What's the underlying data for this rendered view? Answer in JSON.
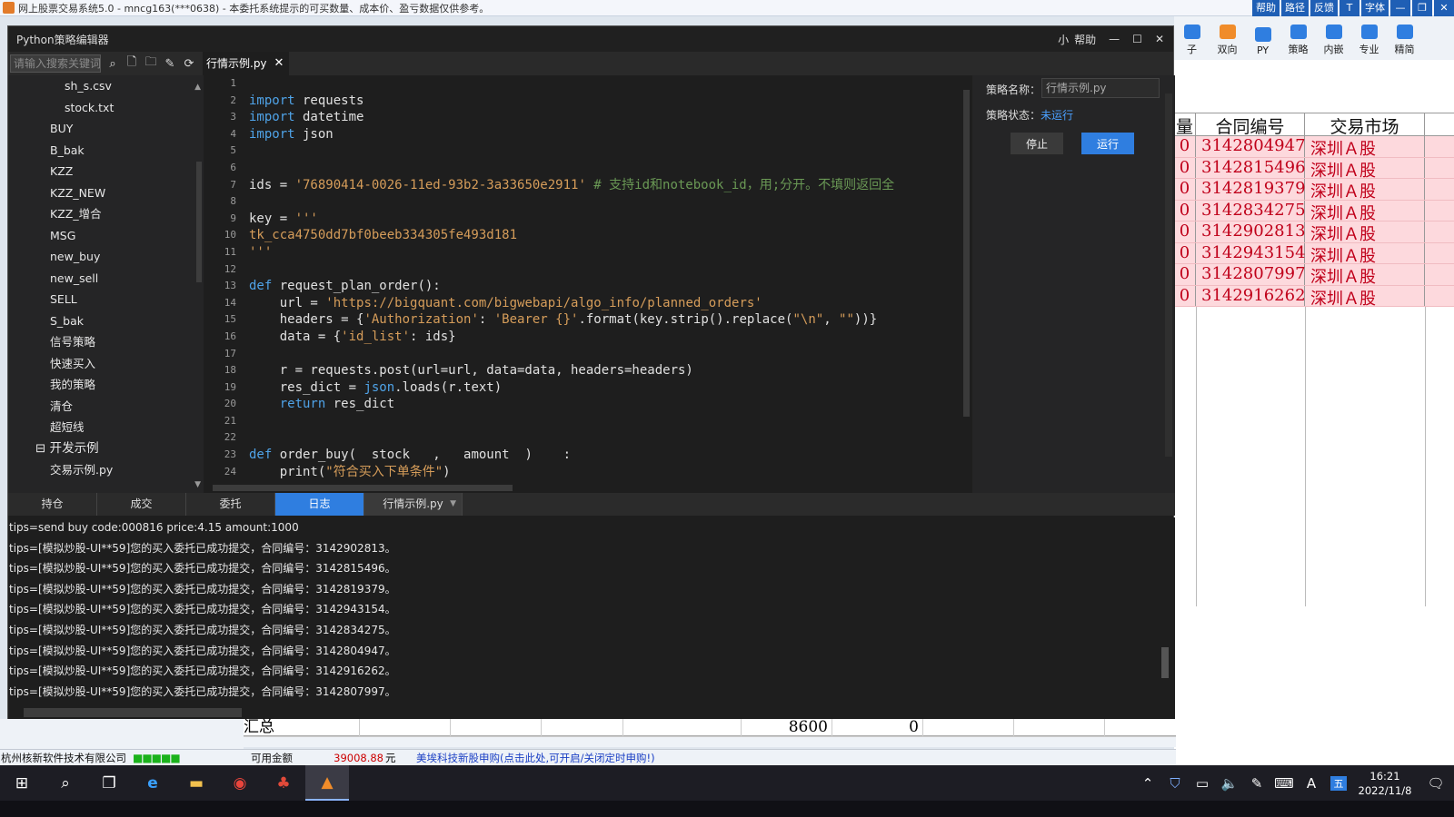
{
  "app": {
    "title": "网上股票交易系统5.0 - mncg163(***0638) - 本委托系统提示的可买数量、成本价、盈亏数据仅供参考。",
    "top_buttons": [
      "帮助",
      "路径",
      "反馈",
      "T",
      "字体",
      "—",
      "❐",
      "✕"
    ]
  },
  "right_toolbar": {
    "items": [
      "子",
      "双向",
      "PY",
      "策略",
      "内嵌",
      "专业",
      "精简"
    ],
    "icon_colors": [
      "#2f7ee0",
      "#f08c2a",
      "#2f7ee0",
      "#2f7ee0",
      "#2f7ee0",
      "#2f7ee0",
      "#2f7ee0"
    ]
  },
  "right_table": {
    "headers": [
      "量",
      "合同编号",
      "交易市场"
    ],
    "rows": [
      [
        "0",
        "3142804947",
        "深圳Ａ股"
      ],
      [
        "0",
        "3142815496",
        "深圳Ａ股"
      ],
      [
        "0",
        "3142819379",
        "深圳Ａ股"
      ],
      [
        "0",
        "3142834275",
        "深圳Ａ股"
      ],
      [
        "0",
        "3142902813",
        "深圳Ａ股"
      ],
      [
        "0",
        "3142943154",
        "深圳Ａ股"
      ],
      [
        "0",
        "3142807997",
        "深圳Ａ股"
      ],
      [
        "0",
        "3142916262",
        "深圳Ａ股"
      ]
    ]
  },
  "editor": {
    "title": "Python策略编辑器",
    "small_label": "小",
    "help_label": "帮助",
    "search_placeholder": "请输入搜索关键词",
    "file_tab": "行情示例.py",
    "tree": [
      {
        "label": "sh_s.csv",
        "indent": 2
      },
      {
        "label": "stock.txt",
        "indent": 2
      },
      {
        "label": "BUY",
        "indent": 1
      },
      {
        "label": "B_bak",
        "indent": 1
      },
      {
        "label": "KZZ",
        "indent": 1
      },
      {
        "label": "KZZ_NEW",
        "indent": 1
      },
      {
        "label": "KZZ_增合",
        "indent": 1
      },
      {
        "label": "MSG",
        "indent": 1
      },
      {
        "label": "new_buy",
        "indent": 1
      },
      {
        "label": "new_sell",
        "indent": 1
      },
      {
        "label": "SELL",
        "indent": 1
      },
      {
        "label": "S_bak",
        "indent": 1
      },
      {
        "label": "信号策略",
        "indent": 1
      },
      {
        "label": "快速买入",
        "indent": 1
      },
      {
        "label": "我的策略",
        "indent": 1
      },
      {
        "label": "清仓",
        "indent": 1
      },
      {
        "label": "超短线",
        "indent": 1
      },
      {
        "label": "⊟ 开发示例",
        "indent": 0
      },
      {
        "label": "交易示例.py",
        "indent": 1
      }
    ],
    "line_numbers": [
      "1",
      "2",
      "3",
      "4",
      "5",
      "6",
      "7",
      "8",
      "9",
      "10",
      "11",
      "12",
      "13",
      "14",
      "15",
      "16",
      "17",
      "18",
      "19",
      "20",
      "21",
      "22",
      "23",
      "24"
    ],
    "code_lines": [
      [],
      [
        [
          "kw",
          "import"
        ],
        [
          "fn",
          " requests"
        ]
      ],
      [
        [
          "kw",
          "import"
        ],
        [
          "fn",
          " datetime"
        ]
      ],
      [
        [
          "kw",
          "import"
        ],
        [
          "fn",
          " json"
        ]
      ],
      [],
      [],
      [
        [
          "fn",
          "ids = "
        ],
        [
          "st",
          "'76890414-0026-11ed-93b2-3a33650e2911'"
        ],
        [
          "cm",
          " # 支持id和notebook_id，用;分开。不填则返回全"
        ]
      ],
      [],
      [
        [
          "fn",
          "key = "
        ],
        [
          "st",
          "'''"
        ]
      ],
      [
        [
          "st",
          "tk_cca4750dd7bf0beeb334305fe493d181"
        ]
      ],
      [
        [
          "st",
          "'''"
        ]
      ],
      [],
      [
        [
          "kw",
          "def"
        ],
        [
          "fn",
          " request_plan_order():"
        ]
      ],
      [
        [
          "fn",
          "    url = "
        ],
        [
          "st",
          "'https://bigquant.com/bigwebapi/algo_info/planned_orders'"
        ]
      ],
      [
        [
          "fn",
          "    headers = {"
        ],
        [
          "st",
          "'Authorization'"
        ],
        [
          "fn",
          ": "
        ],
        [
          "st",
          "'Bearer {}'"
        ],
        [
          "fn",
          ".format(key.strip().replace("
        ],
        [
          "st",
          "\"\\n\""
        ],
        [
          "fn",
          ", "
        ],
        [
          "st",
          "\"\""
        ],
        [
          "fn",
          "))}"
        ]
      ],
      [
        [
          "fn",
          "    data = {"
        ],
        [
          "st",
          "'id_list'"
        ],
        [
          "fn",
          ": ids}"
        ]
      ],
      [],
      [
        [
          "fn",
          "    r = requests.post(url=url, data=data, headers=headers)"
        ]
      ],
      [
        [
          "fn",
          "    res_dict = "
        ],
        [
          "kw",
          "json"
        ],
        [
          "fn",
          ".loads(r.text)"
        ]
      ],
      [
        [
          "kw",
          "    return"
        ],
        [
          "fn",
          " res_dict"
        ]
      ],
      [],
      [],
      [
        [
          "kw",
          "def"
        ],
        [
          "fn",
          " order_buy(  stock   ,   amount  )    :"
        ]
      ],
      [
        [
          "fn",
          "    print("
        ],
        [
          "st",
          "\"符合买入下单条件\""
        ],
        [
          "fn",
          ")"
        ]
      ]
    ],
    "strategy": {
      "name_label": "策略名称：",
      "name_value": "行情示例.py",
      "status_label": "策略状态：",
      "status_value": "未运行",
      "stop_label": "停止",
      "run_label": "运行"
    },
    "bottom_tabs": [
      "持仓",
      "成交",
      "委托",
      "日志"
    ],
    "active_tab": "日志",
    "file_dropdown": "行情示例.py",
    "log_lines": [
      "tips=send buy code:000816 price:4.15 amount:1000",
      "tips=[模拟炒股-UI**59]您的买入委托已成功提交，合同编号：3142902813。",
      "tips=[模拟炒股-UI**59]您的买入委托已成功提交，合同编号：3142815496。",
      "tips=[模拟炒股-UI**59]您的买入委托已成功提交，合同编号：3142819379。",
      "tips=[模拟炒股-UI**59]您的买入委托已成功提交，合同编号：3142943154。",
      "tips=[模拟炒股-UI**59]您的买入委托已成功提交，合同编号：3142834275。",
      "tips=[模拟炒股-UI**59]您的买入委托已成功提交，合同编号：3142804947。",
      "tips=[模拟炒股-UI**59]您的买入委托已成功提交，合同编号：3142916262。",
      "tips=[模拟炒股-UI**59]您的买入委托已成功提交，合同编号：3142807997。"
    ]
  },
  "summary": {
    "label": "汇总",
    "total_qty": "8600",
    "total_other": "0"
  },
  "status_bar": {
    "company": "杭州核新软件技术有限公司",
    "indicator": "■■■■■",
    "available_label": "可用金额",
    "available_amount": "39008.88",
    "unit": "元",
    "ipo_notice": "美埃科技新股申购(点击此处,可开启/关闭定时申购!)"
  },
  "taskbar": {
    "time": "16:21",
    "date": "2022/11/8",
    "ime": "A",
    "ime2": "五"
  }
}
